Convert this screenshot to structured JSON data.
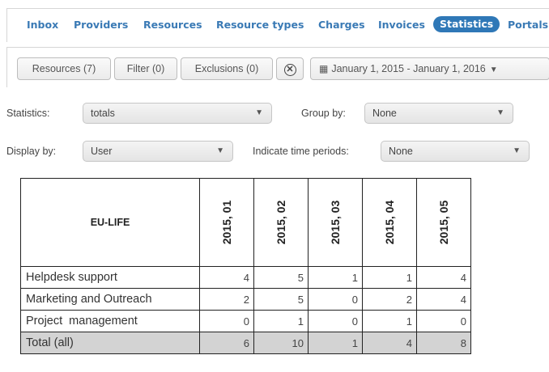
{
  "nav": {
    "tabs": [
      {
        "label": "Inbox"
      },
      {
        "label": "Providers"
      },
      {
        "label": "Resources"
      },
      {
        "label": "Resource types"
      },
      {
        "label": "Charges"
      },
      {
        "label": "Invoices"
      },
      {
        "label": "Statistics",
        "active": true
      },
      {
        "label": "Portals"
      }
    ]
  },
  "toolbar": {
    "resources_label": "Resources (7)",
    "filter_label": "Filter (0)",
    "exclusions_label": "Exclusions (0)",
    "clear_symbol": "✕",
    "date_range": "January 1, 2015 - January 1, 2016"
  },
  "controls": {
    "statistics_label": "Statistics:",
    "statistics_value": "totals",
    "group_by_label": "Group by:",
    "group_by_value": "None",
    "display_by_label": "Display by:",
    "display_by_value": "User",
    "time_periods_label": "Indicate time periods:",
    "time_periods_value": "None"
  },
  "table": {
    "title": "EU-LIFE",
    "columns": [
      "2015, 01",
      "2015, 02",
      "2015, 03",
      "2015, 04",
      "2015, 05"
    ],
    "rows": [
      {
        "label": "Helpdesk support",
        "values": [
          "4",
          "5",
          "1",
          "1",
          "4"
        ]
      },
      {
        "label": "Marketing and Outreach",
        "values": [
          "2",
          "5",
          "0",
          "2",
          "4"
        ]
      },
      {
        "label": "Project  management",
        "values": [
          "0",
          "1",
          "0",
          "1",
          "0"
        ]
      }
    ],
    "total": {
      "label": "Total (all)",
      "values": [
        "6",
        "10",
        "1",
        "4",
        "8"
      ]
    }
  },
  "colors": {
    "accent": "#2f78b7",
    "link": "#3a7ab5",
    "total_bg": "#d3d3d3"
  }
}
